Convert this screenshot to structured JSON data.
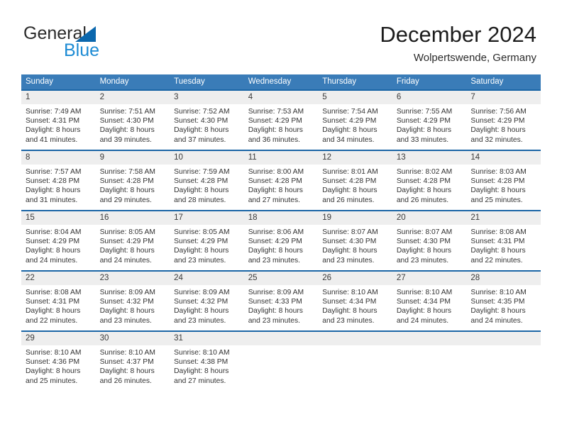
{
  "brand": {
    "name_part1": "General",
    "name_part2": "Blue",
    "triangle_color": "#0b67ad",
    "blue_text_color": "#1c8bd4"
  },
  "header": {
    "title": "December 2024",
    "subtitle": "Wolpertswende, Germany"
  },
  "theme": {
    "header_row_bg": "#3a7cb8",
    "week_separator": "#1b66a6",
    "day_band_bg": "#eeeeee",
    "text_color": "#333333"
  },
  "weekdays": [
    "Sunday",
    "Monday",
    "Tuesday",
    "Wednesday",
    "Thursday",
    "Friday",
    "Saturday"
  ],
  "weeks": [
    [
      {
        "day": "1",
        "sunrise": "Sunrise: 7:49 AM",
        "sunset": "Sunset: 4:31 PM",
        "daylight1": "Daylight: 8 hours",
        "daylight2": "and 41 minutes."
      },
      {
        "day": "2",
        "sunrise": "Sunrise: 7:51 AM",
        "sunset": "Sunset: 4:30 PM",
        "daylight1": "Daylight: 8 hours",
        "daylight2": "and 39 minutes."
      },
      {
        "day": "3",
        "sunrise": "Sunrise: 7:52 AM",
        "sunset": "Sunset: 4:30 PM",
        "daylight1": "Daylight: 8 hours",
        "daylight2": "and 37 minutes."
      },
      {
        "day": "4",
        "sunrise": "Sunrise: 7:53 AM",
        "sunset": "Sunset: 4:29 PM",
        "daylight1": "Daylight: 8 hours",
        "daylight2": "and 36 minutes."
      },
      {
        "day": "5",
        "sunrise": "Sunrise: 7:54 AM",
        "sunset": "Sunset: 4:29 PM",
        "daylight1": "Daylight: 8 hours",
        "daylight2": "and 34 minutes."
      },
      {
        "day": "6",
        "sunrise": "Sunrise: 7:55 AM",
        "sunset": "Sunset: 4:29 PM",
        "daylight1": "Daylight: 8 hours",
        "daylight2": "and 33 minutes."
      },
      {
        "day": "7",
        "sunrise": "Sunrise: 7:56 AM",
        "sunset": "Sunset: 4:29 PM",
        "daylight1": "Daylight: 8 hours",
        "daylight2": "and 32 minutes."
      }
    ],
    [
      {
        "day": "8",
        "sunrise": "Sunrise: 7:57 AM",
        "sunset": "Sunset: 4:28 PM",
        "daylight1": "Daylight: 8 hours",
        "daylight2": "and 31 minutes."
      },
      {
        "day": "9",
        "sunrise": "Sunrise: 7:58 AM",
        "sunset": "Sunset: 4:28 PM",
        "daylight1": "Daylight: 8 hours",
        "daylight2": "and 29 minutes."
      },
      {
        "day": "10",
        "sunrise": "Sunrise: 7:59 AM",
        "sunset": "Sunset: 4:28 PM",
        "daylight1": "Daylight: 8 hours",
        "daylight2": "and 28 minutes."
      },
      {
        "day": "11",
        "sunrise": "Sunrise: 8:00 AM",
        "sunset": "Sunset: 4:28 PM",
        "daylight1": "Daylight: 8 hours",
        "daylight2": "and 27 minutes."
      },
      {
        "day": "12",
        "sunrise": "Sunrise: 8:01 AM",
        "sunset": "Sunset: 4:28 PM",
        "daylight1": "Daylight: 8 hours",
        "daylight2": "and 26 minutes."
      },
      {
        "day": "13",
        "sunrise": "Sunrise: 8:02 AM",
        "sunset": "Sunset: 4:28 PM",
        "daylight1": "Daylight: 8 hours",
        "daylight2": "and 26 minutes."
      },
      {
        "day": "14",
        "sunrise": "Sunrise: 8:03 AM",
        "sunset": "Sunset: 4:28 PM",
        "daylight1": "Daylight: 8 hours",
        "daylight2": "and 25 minutes."
      }
    ],
    [
      {
        "day": "15",
        "sunrise": "Sunrise: 8:04 AM",
        "sunset": "Sunset: 4:29 PM",
        "daylight1": "Daylight: 8 hours",
        "daylight2": "and 24 minutes."
      },
      {
        "day": "16",
        "sunrise": "Sunrise: 8:05 AM",
        "sunset": "Sunset: 4:29 PM",
        "daylight1": "Daylight: 8 hours",
        "daylight2": "and 24 minutes."
      },
      {
        "day": "17",
        "sunrise": "Sunrise: 8:05 AM",
        "sunset": "Sunset: 4:29 PM",
        "daylight1": "Daylight: 8 hours",
        "daylight2": "and 23 minutes."
      },
      {
        "day": "18",
        "sunrise": "Sunrise: 8:06 AM",
        "sunset": "Sunset: 4:29 PM",
        "daylight1": "Daylight: 8 hours",
        "daylight2": "and 23 minutes."
      },
      {
        "day": "19",
        "sunrise": "Sunrise: 8:07 AM",
        "sunset": "Sunset: 4:30 PM",
        "daylight1": "Daylight: 8 hours",
        "daylight2": "and 23 minutes."
      },
      {
        "day": "20",
        "sunrise": "Sunrise: 8:07 AM",
        "sunset": "Sunset: 4:30 PM",
        "daylight1": "Daylight: 8 hours",
        "daylight2": "and 23 minutes."
      },
      {
        "day": "21",
        "sunrise": "Sunrise: 8:08 AM",
        "sunset": "Sunset: 4:31 PM",
        "daylight1": "Daylight: 8 hours",
        "daylight2": "and 22 minutes."
      }
    ],
    [
      {
        "day": "22",
        "sunrise": "Sunrise: 8:08 AM",
        "sunset": "Sunset: 4:31 PM",
        "daylight1": "Daylight: 8 hours",
        "daylight2": "and 22 minutes."
      },
      {
        "day": "23",
        "sunrise": "Sunrise: 8:09 AM",
        "sunset": "Sunset: 4:32 PM",
        "daylight1": "Daylight: 8 hours",
        "daylight2": "and 23 minutes."
      },
      {
        "day": "24",
        "sunrise": "Sunrise: 8:09 AM",
        "sunset": "Sunset: 4:32 PM",
        "daylight1": "Daylight: 8 hours",
        "daylight2": "and 23 minutes."
      },
      {
        "day": "25",
        "sunrise": "Sunrise: 8:09 AM",
        "sunset": "Sunset: 4:33 PM",
        "daylight1": "Daylight: 8 hours",
        "daylight2": "and 23 minutes."
      },
      {
        "day": "26",
        "sunrise": "Sunrise: 8:10 AM",
        "sunset": "Sunset: 4:34 PM",
        "daylight1": "Daylight: 8 hours",
        "daylight2": "and 23 minutes."
      },
      {
        "day": "27",
        "sunrise": "Sunrise: 8:10 AM",
        "sunset": "Sunset: 4:34 PM",
        "daylight1": "Daylight: 8 hours",
        "daylight2": "and 24 minutes."
      },
      {
        "day": "28",
        "sunrise": "Sunrise: 8:10 AM",
        "sunset": "Sunset: 4:35 PM",
        "daylight1": "Daylight: 8 hours",
        "daylight2": "and 24 minutes."
      }
    ],
    [
      {
        "day": "29",
        "sunrise": "Sunrise: 8:10 AM",
        "sunset": "Sunset: 4:36 PM",
        "daylight1": "Daylight: 8 hours",
        "daylight2": "and 25 minutes."
      },
      {
        "day": "30",
        "sunrise": "Sunrise: 8:10 AM",
        "sunset": "Sunset: 4:37 PM",
        "daylight1": "Daylight: 8 hours",
        "daylight2": "and 26 minutes."
      },
      {
        "day": "31",
        "sunrise": "Sunrise: 8:10 AM",
        "sunset": "Sunset: 4:38 PM",
        "daylight1": "Daylight: 8 hours",
        "daylight2": "and 27 minutes."
      },
      {
        "day": "",
        "sunrise": "",
        "sunset": "",
        "daylight1": "",
        "daylight2": ""
      },
      {
        "day": "",
        "sunrise": "",
        "sunset": "",
        "daylight1": "",
        "daylight2": ""
      },
      {
        "day": "",
        "sunrise": "",
        "sunset": "",
        "daylight1": "",
        "daylight2": ""
      },
      {
        "day": "",
        "sunrise": "",
        "sunset": "",
        "daylight1": "",
        "daylight2": ""
      }
    ]
  ]
}
